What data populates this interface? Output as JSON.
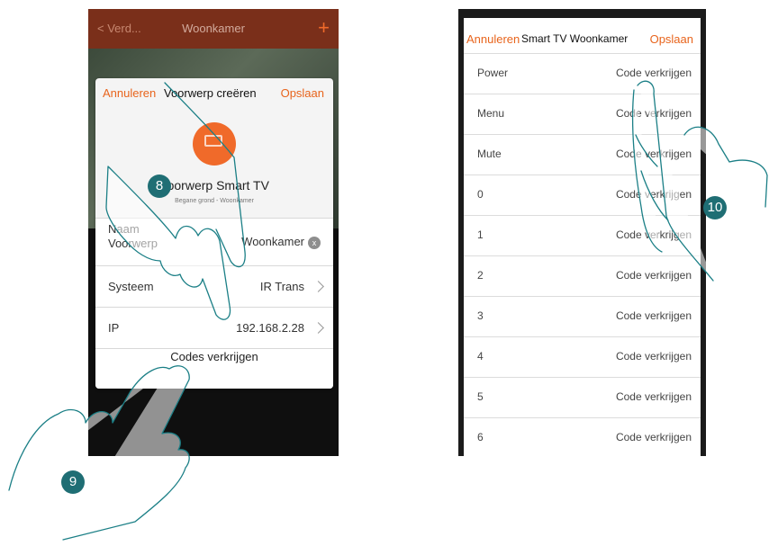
{
  "left_screen": {
    "back_label": "< Verd...",
    "title": "Woonkamer",
    "add_icon": "plus-icon"
  },
  "dialog": {
    "cancel_label": "Annuleren",
    "title": "Voorwerp creëren",
    "save_label": "Opslaan",
    "icon": "tv-icon",
    "object_name": "Voorwerp Smart TV",
    "object_location": "Begane grond - Woonkamer",
    "rows": [
      {
        "label": "Naam Voorwerp",
        "value": "Woonkamer"
      },
      {
        "label": "Systeem",
        "value": "IR Trans"
      },
      {
        "label": "IP",
        "value": "192.168.2.28"
      }
    ],
    "action_label": "Codes verkrijgen"
  },
  "right_screen": {
    "cancel_label": "Annuleren",
    "title": "Smart TV Woonkamer",
    "save_label": "Opslaan",
    "items": [
      {
        "label": "Power",
        "action": "Code verkrijgen"
      },
      {
        "label": "Menu",
        "action": "Code verkrijgen"
      },
      {
        "label": "Mute",
        "action": "Code verkrijgen"
      },
      {
        "label": "0",
        "action": "Code verkrijgen"
      },
      {
        "label": "1",
        "action": "Code verkrijgen"
      },
      {
        "label": "2",
        "action": "Code verkrijgen"
      },
      {
        "label": "3",
        "action": "Code verkrijgen"
      },
      {
        "label": "4",
        "action": "Code verkrijgen"
      },
      {
        "label": "5",
        "action": "Code verkrijgen"
      },
      {
        "label": "6",
        "action": "Code verkrijgen"
      }
    ]
  },
  "steps": [
    "8",
    "9",
    "10"
  ],
  "colors": {
    "accent": "#e8641c",
    "badge": "#1f6e74",
    "hand_outline": "#1b7f86"
  }
}
